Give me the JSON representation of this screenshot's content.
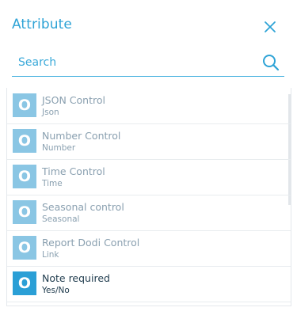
{
  "header": {
    "title": "Attribute",
    "close_icon": "close-icon"
  },
  "search": {
    "placeholder": "Search",
    "value": "",
    "icon": "search-icon"
  },
  "colors": {
    "accent": "#2ea3d6",
    "icon_bg": "#8ac6e4",
    "icon_bg_selected": "#2a9fd6"
  },
  "items": [
    {
      "icon_letter": "O",
      "name": "JSON Control",
      "type": "Json",
      "selected": false
    },
    {
      "icon_letter": "O",
      "name": "Number Control",
      "type": "Number",
      "selected": false
    },
    {
      "icon_letter": "O",
      "name": "Time Control",
      "type": "Time",
      "selected": false
    },
    {
      "icon_letter": "O",
      "name": "Seasonal control",
      "type": "Seasonal",
      "selected": false
    },
    {
      "icon_letter": "O",
      "name": "Report Dodi Control",
      "type": "Link",
      "selected": false
    },
    {
      "icon_letter": "O",
      "name": "Note required",
      "type": "Yes/No",
      "selected": true
    }
  ]
}
